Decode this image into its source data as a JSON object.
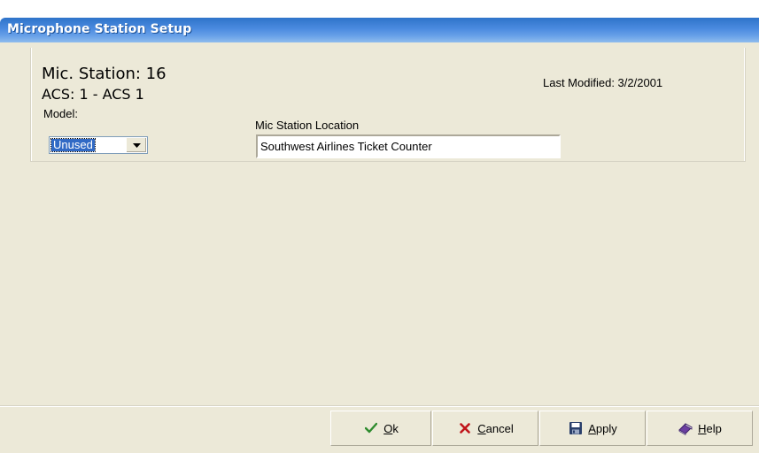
{
  "window": {
    "title": "Microphone Station Setup"
  },
  "station": {
    "title": "Mic. Station: 16",
    "acs": "ACS: 1 - ACS 1",
    "last_modified": "Last Modified:  3/2/2001"
  },
  "model": {
    "label": "Model:",
    "selected": "Unused"
  },
  "location": {
    "label": "Mic Station Location",
    "value": "Southwest Airlines Ticket Counter"
  },
  "buttons": {
    "ok": {
      "accel": "O",
      "rest": "k",
      "icon": "checkmark-icon"
    },
    "cancel": {
      "accel": "C",
      "rest": "ancel",
      "icon": "close-icon"
    },
    "apply": {
      "accel": "A",
      "rest": "pply",
      "icon": "save-disk-icon"
    },
    "help": {
      "accel": "H",
      "rest": "elp",
      "icon": "help-book-icon"
    }
  },
  "colors": {
    "titlebar": "#2e73c9",
    "dialog_background": "#ece9d8",
    "selection": "#316ac5",
    "ok_check": "#2e8b2e",
    "cancel_x": "#c0141a"
  }
}
